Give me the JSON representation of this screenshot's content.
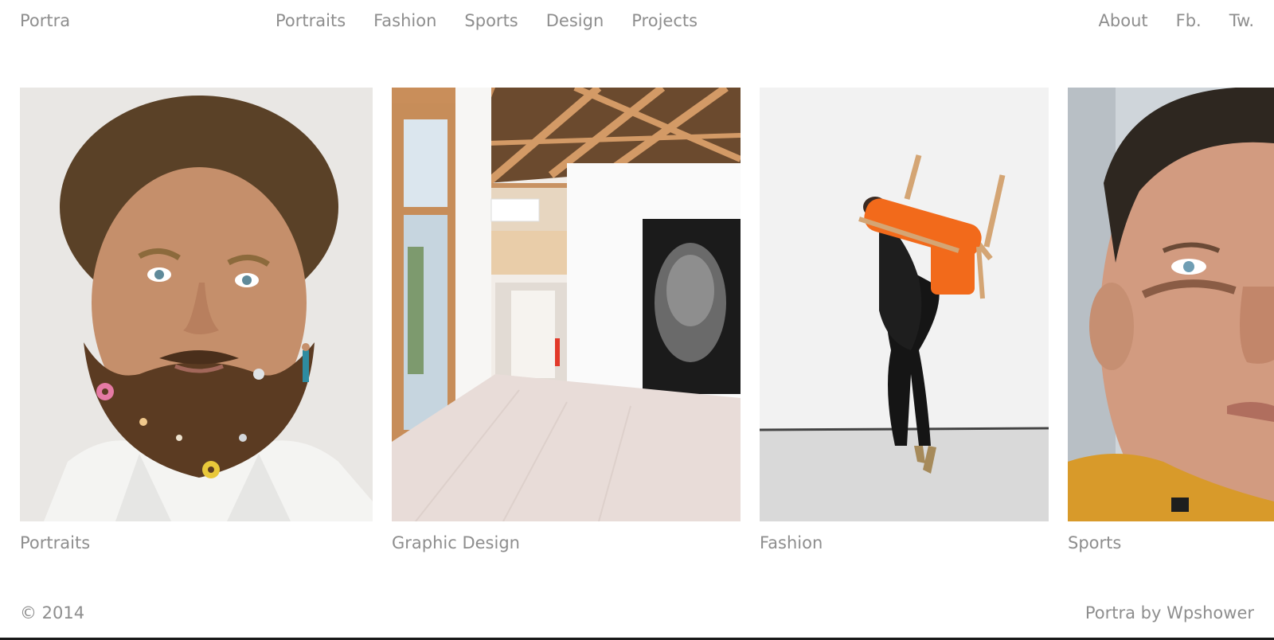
{
  "site": {
    "logo": "Portra"
  },
  "nav": {
    "main": [
      {
        "label": "Portraits"
      },
      {
        "label": "Fashion"
      },
      {
        "label": "Sports"
      },
      {
        "label": "Design"
      },
      {
        "label": "Projects"
      }
    ],
    "right": [
      {
        "label": "About"
      },
      {
        "label": "Fb."
      },
      {
        "label": "Tw."
      }
    ]
  },
  "gallery": {
    "items": [
      {
        "caption": "Portraits"
      },
      {
        "caption": "Graphic Design"
      },
      {
        "caption": "Fashion"
      },
      {
        "caption": "Sports"
      }
    ]
  },
  "footer": {
    "copyright": "© 2014",
    "credit": "Portra by Wpshower"
  },
  "colors": {
    "text": "#8e8e8e",
    "background": "#ffffff",
    "accent_orange": "#f26a1b"
  }
}
